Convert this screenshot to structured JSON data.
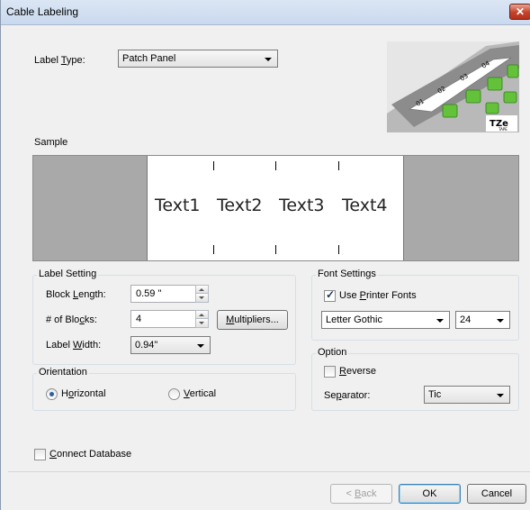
{
  "window": {
    "title": "Cable Labeling",
    "close_glyph": "✕"
  },
  "label_type": {
    "label_prefix": "Label ",
    "label_ul": "T",
    "label_suffix": "ype:",
    "value": "Patch Panel"
  },
  "sample": {
    "heading": "Sample",
    "texts": [
      "Text1",
      "Text2",
      "Text3",
      "Text4"
    ]
  },
  "label_setting": {
    "title": "Label Setting",
    "block_length": {
      "label_prefix": "Block ",
      "label_ul": "L",
      "label_suffix": "ength:",
      "value": "0.59 \""
    },
    "num_blocks": {
      "label_prefix": "# of Blo",
      "label_ul": "c",
      "label_suffix": "ks:",
      "value": "4"
    },
    "multipliers_button": {
      "label_ul": "M",
      "label_suffix": "ultipliers..."
    },
    "label_width": {
      "label_prefix": "Label ",
      "label_ul": "W",
      "label_suffix": "idth:",
      "value": "0.94\""
    }
  },
  "orientation": {
    "title": "Orientation",
    "horizontal": {
      "label_prefix": "H",
      "label_ul": "o",
      "label_suffix": "rizontal",
      "selected": true
    },
    "vertical": {
      "label_ul": "V",
      "label_suffix": "ertical",
      "selected": false
    }
  },
  "font_settings": {
    "title": "Font Settings",
    "use_printer_fonts": {
      "label_prefix": "Use ",
      "label_ul": "P",
      "label_suffix": "rinter Fonts",
      "checked": true
    },
    "font_name": "Letter Gothic",
    "font_size": "24"
  },
  "option": {
    "title": "Option",
    "reverse": {
      "label_ul": "R",
      "label_suffix": "everse",
      "checked": false
    },
    "separator": {
      "label_prefix": "Se",
      "label_ul": "p",
      "label_suffix": "arator:",
      "value": "Tic"
    }
  },
  "connect_database": {
    "label_ul": "C",
    "label_suffix": "onnect Database",
    "checked": false
  },
  "buttons": {
    "back": {
      "label_prefix": "< ",
      "label_ul": "B",
      "label_suffix": "ack"
    },
    "ok": "OK",
    "cancel": "Cancel"
  },
  "illustration": {
    "numbers": [
      "01",
      "02",
      "03",
      "04"
    ],
    "logo": "TZe",
    "logo_sub": "TAPE"
  }
}
